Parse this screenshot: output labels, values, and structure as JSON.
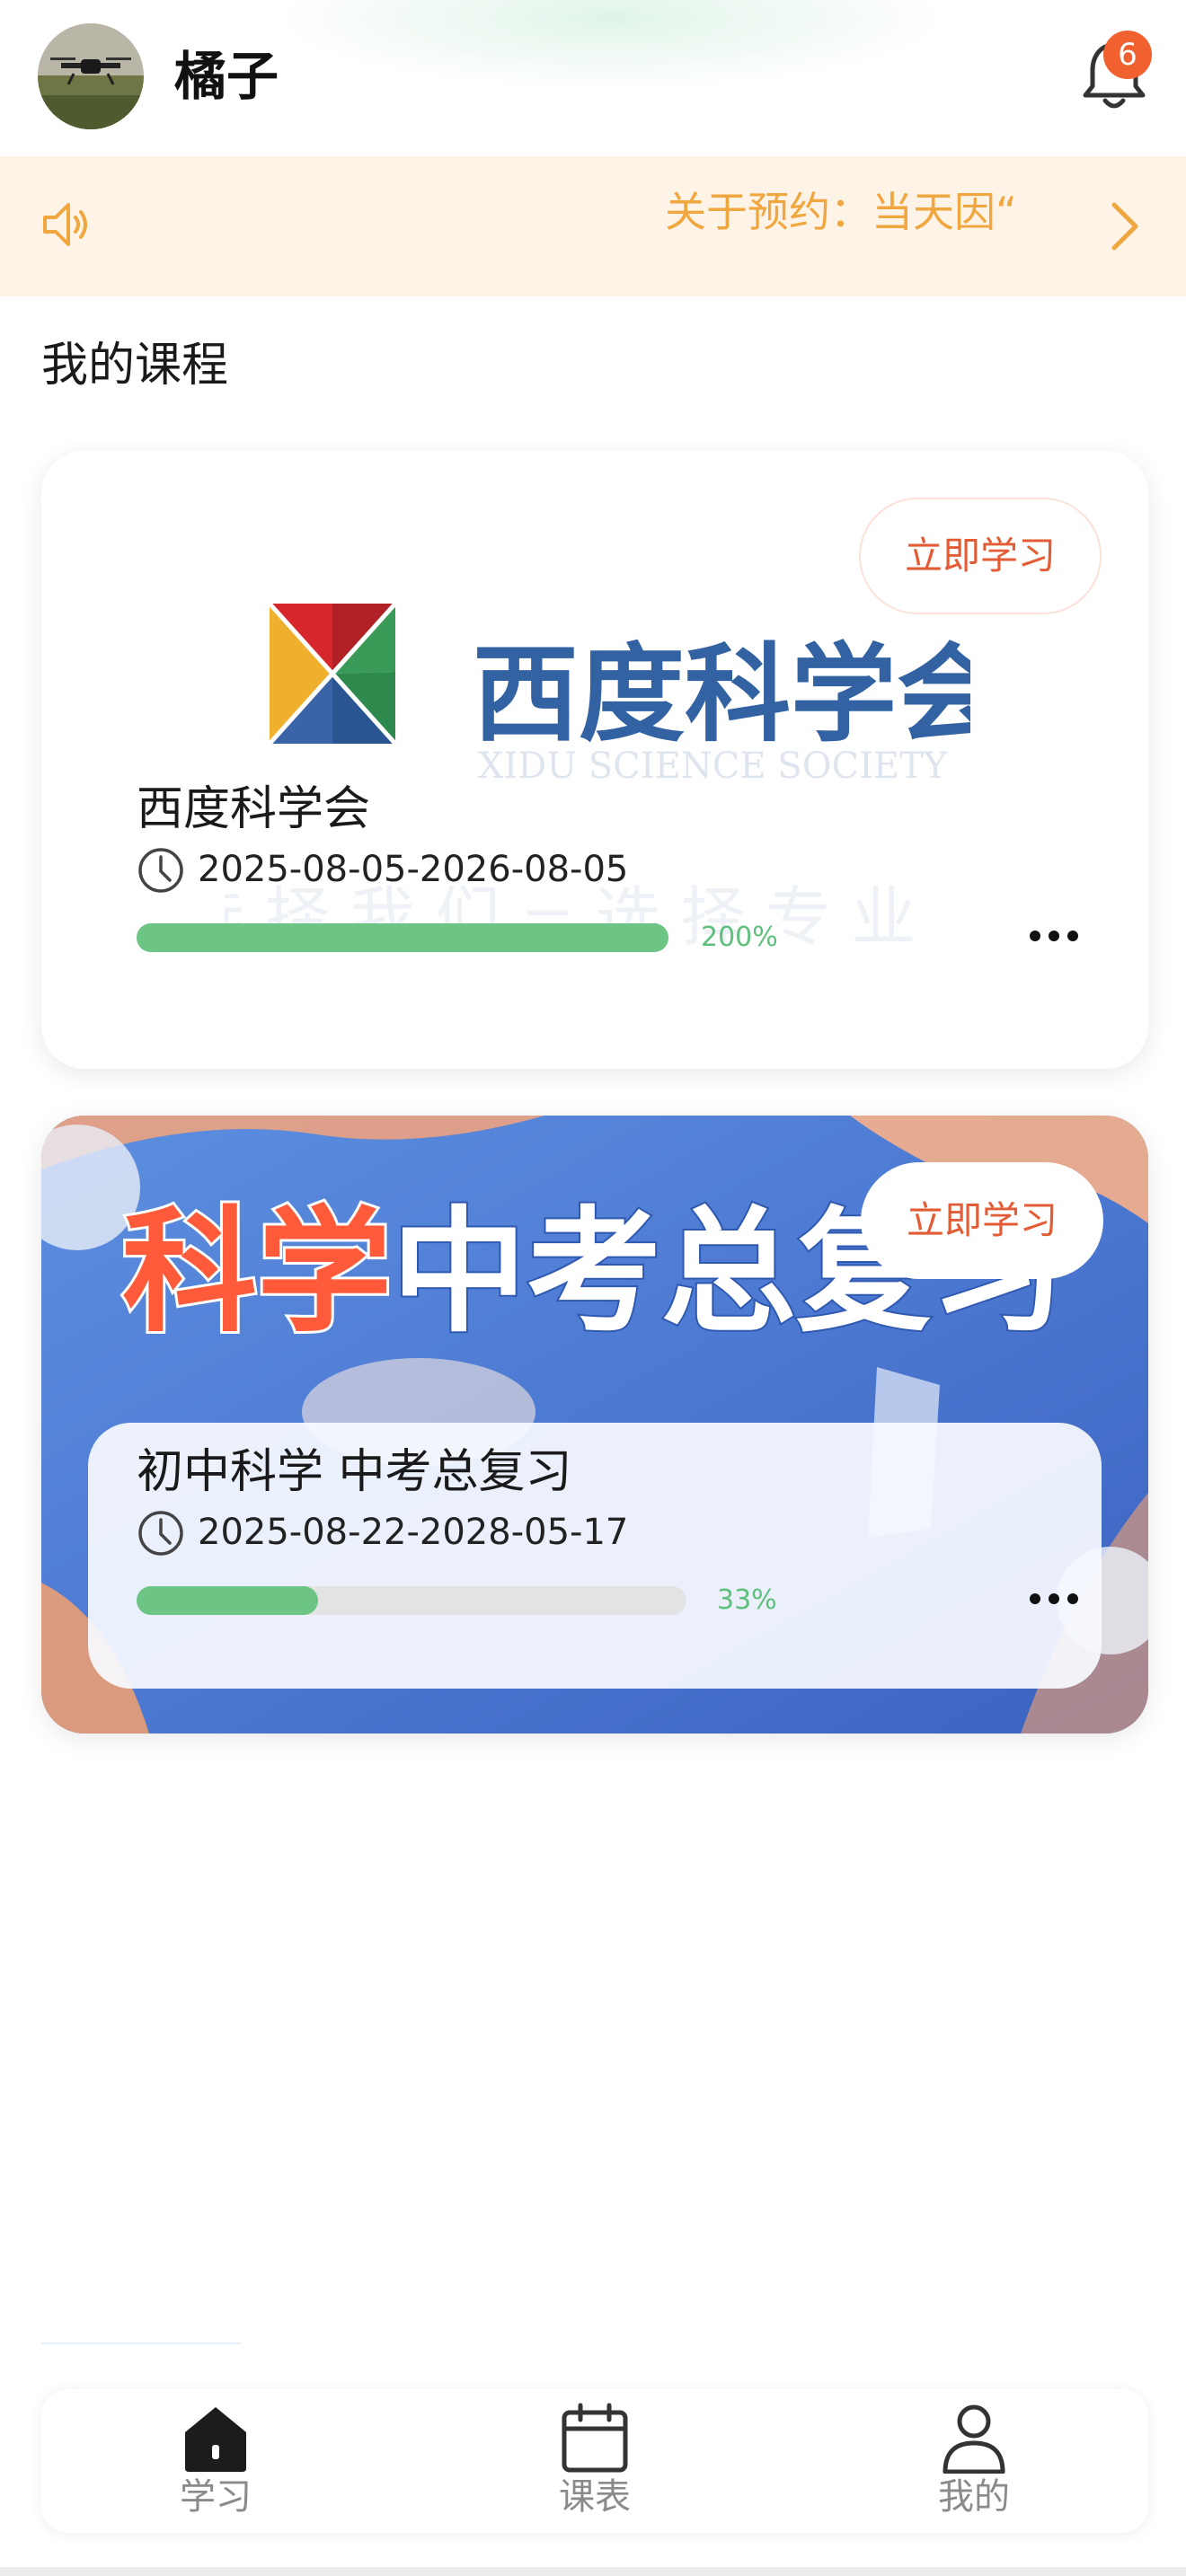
{
  "header": {
    "username": "橘子",
    "notification_count": "6"
  },
  "notice": {
    "text": "关于预约：当天因“"
  },
  "section_title": "我的课程",
  "courses": [
    {
      "name": "西度科学会",
      "date_range": "2025-08-05-2026-08-05",
      "progress_label": "200%",
      "progress": 2.0,
      "action_label": "立即学习",
      "logo": {
        "title": "西度科学会",
        "subtitle": "XIDU SCIENCE  SOCIETY",
        "slogan": "选 择 我 们 = 选 择 专 业"
      }
    },
    {
      "name": "初中科学 中考总复习",
      "date_range": "2025-08-22-2028-05-17",
      "progress_label": "33%",
      "progress": 0.33,
      "action_label": "立即学习",
      "banner": {
        "title_red": "科学",
        "title_white": "中考总复习"
      }
    }
  ],
  "tabbar": {
    "items": [
      {
        "label": "学习",
        "icon": "home-icon"
      },
      {
        "label": "课表",
        "icon": "calendar-icon"
      },
      {
        "label": "我的",
        "icon": "profile-icon"
      }
    ]
  },
  "colors": {
    "accent": "#e25c35",
    "notice_text": "#f1a73f",
    "notice_bg": "#fdf3e6",
    "progress": "#6cc585",
    "badge": "#f0612f"
  }
}
